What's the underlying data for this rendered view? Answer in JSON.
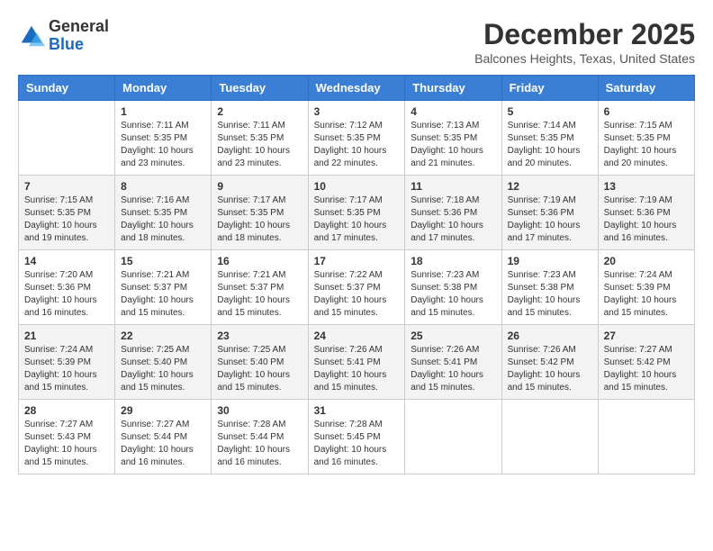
{
  "header": {
    "logo_general": "General",
    "logo_blue": "Blue",
    "month_title": "December 2025",
    "location": "Balcones Heights, Texas, United States"
  },
  "weekdays": [
    "Sunday",
    "Monday",
    "Tuesday",
    "Wednesday",
    "Thursday",
    "Friday",
    "Saturday"
  ],
  "weeks": [
    [
      {
        "day": "",
        "sunrise": "",
        "sunset": "",
        "daylight": ""
      },
      {
        "day": "1",
        "sunrise": "Sunrise: 7:11 AM",
        "sunset": "Sunset: 5:35 PM",
        "daylight": "Daylight: 10 hours and 23 minutes."
      },
      {
        "day": "2",
        "sunrise": "Sunrise: 7:11 AM",
        "sunset": "Sunset: 5:35 PM",
        "daylight": "Daylight: 10 hours and 23 minutes."
      },
      {
        "day": "3",
        "sunrise": "Sunrise: 7:12 AM",
        "sunset": "Sunset: 5:35 PM",
        "daylight": "Daylight: 10 hours and 22 minutes."
      },
      {
        "day": "4",
        "sunrise": "Sunrise: 7:13 AM",
        "sunset": "Sunset: 5:35 PM",
        "daylight": "Daylight: 10 hours and 21 minutes."
      },
      {
        "day": "5",
        "sunrise": "Sunrise: 7:14 AM",
        "sunset": "Sunset: 5:35 PM",
        "daylight": "Daylight: 10 hours and 20 minutes."
      },
      {
        "day": "6",
        "sunrise": "Sunrise: 7:15 AM",
        "sunset": "Sunset: 5:35 PM",
        "daylight": "Daylight: 10 hours and 20 minutes."
      }
    ],
    [
      {
        "day": "7",
        "sunrise": "Sunrise: 7:15 AM",
        "sunset": "Sunset: 5:35 PM",
        "daylight": "Daylight: 10 hours and 19 minutes."
      },
      {
        "day": "8",
        "sunrise": "Sunrise: 7:16 AM",
        "sunset": "Sunset: 5:35 PM",
        "daylight": "Daylight: 10 hours and 18 minutes."
      },
      {
        "day": "9",
        "sunrise": "Sunrise: 7:17 AM",
        "sunset": "Sunset: 5:35 PM",
        "daylight": "Daylight: 10 hours and 18 minutes."
      },
      {
        "day": "10",
        "sunrise": "Sunrise: 7:17 AM",
        "sunset": "Sunset: 5:35 PM",
        "daylight": "Daylight: 10 hours and 17 minutes."
      },
      {
        "day": "11",
        "sunrise": "Sunrise: 7:18 AM",
        "sunset": "Sunset: 5:36 PM",
        "daylight": "Daylight: 10 hours and 17 minutes."
      },
      {
        "day": "12",
        "sunrise": "Sunrise: 7:19 AM",
        "sunset": "Sunset: 5:36 PM",
        "daylight": "Daylight: 10 hours and 17 minutes."
      },
      {
        "day": "13",
        "sunrise": "Sunrise: 7:19 AM",
        "sunset": "Sunset: 5:36 PM",
        "daylight": "Daylight: 10 hours and 16 minutes."
      }
    ],
    [
      {
        "day": "14",
        "sunrise": "Sunrise: 7:20 AM",
        "sunset": "Sunset: 5:36 PM",
        "daylight": "Daylight: 10 hours and 16 minutes."
      },
      {
        "day": "15",
        "sunrise": "Sunrise: 7:21 AM",
        "sunset": "Sunset: 5:37 PM",
        "daylight": "Daylight: 10 hours and 15 minutes."
      },
      {
        "day": "16",
        "sunrise": "Sunrise: 7:21 AM",
        "sunset": "Sunset: 5:37 PM",
        "daylight": "Daylight: 10 hours and 15 minutes."
      },
      {
        "day": "17",
        "sunrise": "Sunrise: 7:22 AM",
        "sunset": "Sunset: 5:37 PM",
        "daylight": "Daylight: 10 hours and 15 minutes."
      },
      {
        "day": "18",
        "sunrise": "Sunrise: 7:23 AM",
        "sunset": "Sunset: 5:38 PM",
        "daylight": "Daylight: 10 hours and 15 minutes."
      },
      {
        "day": "19",
        "sunrise": "Sunrise: 7:23 AM",
        "sunset": "Sunset: 5:38 PM",
        "daylight": "Daylight: 10 hours and 15 minutes."
      },
      {
        "day": "20",
        "sunrise": "Sunrise: 7:24 AM",
        "sunset": "Sunset: 5:39 PM",
        "daylight": "Daylight: 10 hours and 15 minutes."
      }
    ],
    [
      {
        "day": "21",
        "sunrise": "Sunrise: 7:24 AM",
        "sunset": "Sunset: 5:39 PM",
        "daylight": "Daylight: 10 hours and 15 minutes."
      },
      {
        "day": "22",
        "sunrise": "Sunrise: 7:25 AM",
        "sunset": "Sunset: 5:40 PM",
        "daylight": "Daylight: 10 hours and 15 minutes."
      },
      {
        "day": "23",
        "sunrise": "Sunrise: 7:25 AM",
        "sunset": "Sunset: 5:40 PM",
        "daylight": "Daylight: 10 hours and 15 minutes."
      },
      {
        "day": "24",
        "sunrise": "Sunrise: 7:26 AM",
        "sunset": "Sunset: 5:41 PM",
        "daylight": "Daylight: 10 hours and 15 minutes."
      },
      {
        "day": "25",
        "sunrise": "Sunrise: 7:26 AM",
        "sunset": "Sunset: 5:41 PM",
        "daylight": "Daylight: 10 hours and 15 minutes."
      },
      {
        "day": "26",
        "sunrise": "Sunrise: 7:26 AM",
        "sunset": "Sunset: 5:42 PM",
        "daylight": "Daylight: 10 hours and 15 minutes."
      },
      {
        "day": "27",
        "sunrise": "Sunrise: 7:27 AM",
        "sunset": "Sunset: 5:42 PM",
        "daylight": "Daylight: 10 hours and 15 minutes."
      }
    ],
    [
      {
        "day": "28",
        "sunrise": "Sunrise: 7:27 AM",
        "sunset": "Sunset: 5:43 PM",
        "daylight": "Daylight: 10 hours and 15 minutes."
      },
      {
        "day": "29",
        "sunrise": "Sunrise: 7:27 AM",
        "sunset": "Sunset: 5:44 PM",
        "daylight": "Daylight: 10 hours and 16 minutes."
      },
      {
        "day": "30",
        "sunrise": "Sunrise: 7:28 AM",
        "sunset": "Sunset: 5:44 PM",
        "daylight": "Daylight: 10 hours and 16 minutes."
      },
      {
        "day": "31",
        "sunrise": "Sunrise: 7:28 AM",
        "sunset": "Sunset: 5:45 PM",
        "daylight": "Daylight: 10 hours and 16 minutes."
      },
      {
        "day": "",
        "sunrise": "",
        "sunset": "",
        "daylight": ""
      },
      {
        "day": "",
        "sunrise": "",
        "sunset": "",
        "daylight": ""
      },
      {
        "day": "",
        "sunrise": "",
        "sunset": "",
        "daylight": ""
      }
    ]
  ]
}
